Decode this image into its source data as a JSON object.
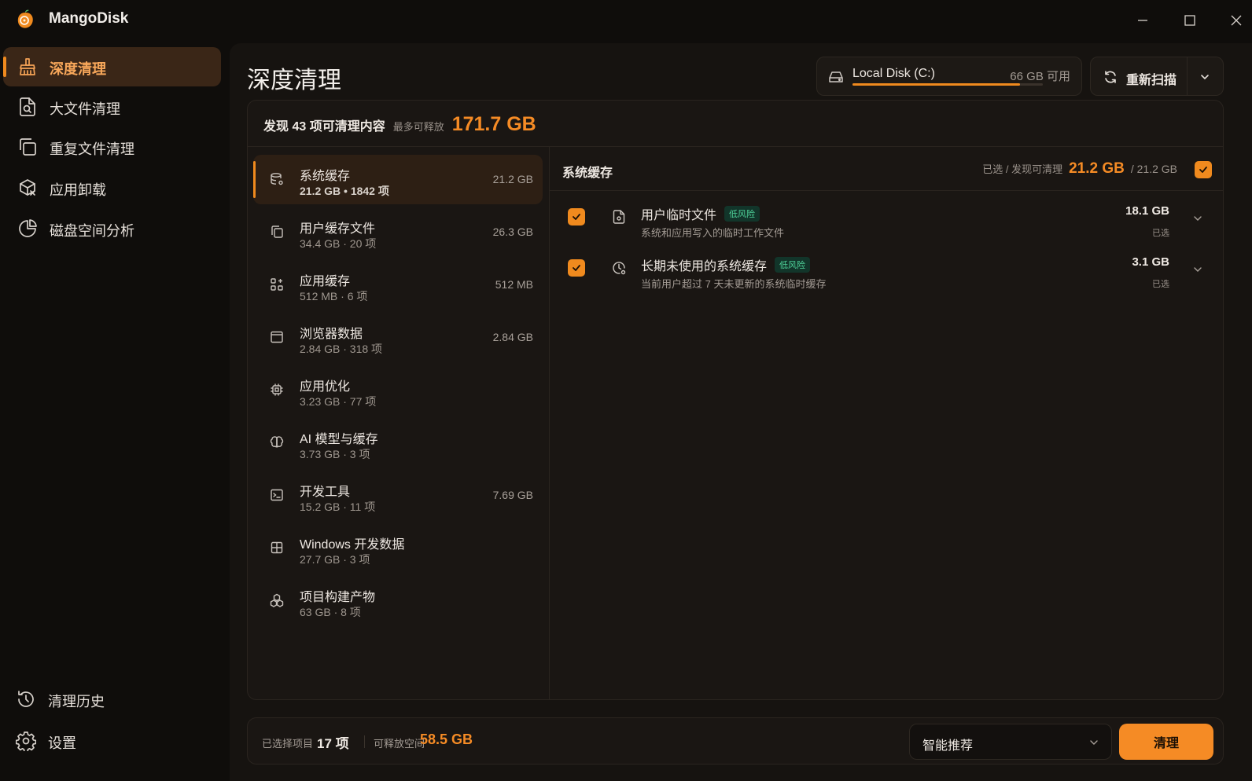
{
  "app": {
    "name": "MangoDisk"
  },
  "sidebar": {
    "items": [
      {
        "label": "深度清理",
        "icon": "broom-icon",
        "active": true
      },
      {
        "label": "大文件清理",
        "icon": "file-search-icon"
      },
      {
        "label": "重复文件清理",
        "icon": "copy-icon"
      },
      {
        "label": "应用卸载",
        "icon": "package-remove-icon"
      },
      {
        "label": "磁盘空间分析",
        "icon": "pie-chart-icon"
      }
    ],
    "bottom": [
      {
        "label": "清理历史",
        "icon": "history-icon"
      },
      {
        "label": "设置",
        "icon": "gear-icon"
      }
    ]
  },
  "header": {
    "title": "深度清理",
    "disk": {
      "name": "Local Disk (C:)",
      "free": "66 GB 可用",
      "used_fraction": 0.88
    },
    "rescan_label": "重新扫描"
  },
  "summary": {
    "text": "发现 43 项可清理内容",
    "sub": "最多可释放",
    "size": "171.7 GB"
  },
  "categories": [
    {
      "name": "系统缓存",
      "meta": "21.2 GB • 1842 项",
      "size": "21.2 GB",
      "icon": "database-gear-icon",
      "active": true
    },
    {
      "name": "用户缓存文件",
      "meta": "34.4 GB · 20 项",
      "size": "26.3 GB",
      "icon": "files-icon"
    },
    {
      "name": "应用缓存",
      "meta": "512 MB · 6 项",
      "size": "512 MB",
      "icon": "apps-icon"
    },
    {
      "name": "浏览器数据",
      "meta": "2.84 GB · 318 项",
      "size": "2.84 GB",
      "icon": "browser-icon"
    },
    {
      "name": "应用优化",
      "meta": "3.23 GB · 77 项",
      "size": "",
      "icon": "chip-icon"
    },
    {
      "name": "AI 模型与缓存",
      "meta": "3.73 GB · 3 项",
      "size": "",
      "icon": "brain-icon"
    },
    {
      "name": "开发工具",
      "meta": "15.2 GB · 11 项",
      "size": "7.69 GB",
      "icon": "terminal-icon"
    },
    {
      "name": "Windows 开发数据",
      "meta": "27.7 GB · 3 项",
      "size": "",
      "icon": "windows-icon"
    },
    {
      "name": "项目构建产物",
      "meta": "63 GB · 8 项",
      "size": "",
      "icon": "boxes-icon"
    }
  ],
  "detail": {
    "title": "系统缓存",
    "label": "已选 / 发现可清理",
    "selected": "21.2 GB",
    "total": "/ 21.2 GB",
    "entries": [
      {
        "name": "用户临时文件",
        "risk": "低风险",
        "desc": "系统和应用写入的临时工作文件",
        "size": "18.1 GB",
        "state": "已选",
        "icon": "file-gear-icon"
      },
      {
        "name": "长期未使用的系统缓存",
        "risk": "低风险",
        "desc": "当前用户超过 7 天未更新的系统临时缓存",
        "size": "3.1 GB",
        "state": "已选",
        "icon": "clock-gear-icon"
      }
    ]
  },
  "footer": {
    "selected_label": "已选择项目",
    "selected_count": "17 项",
    "free_label": "可释放空间",
    "free_size": "58.5 GB",
    "mode": "智能推荐",
    "clean_label": "清理"
  },
  "colors": {
    "accent": "#f58b25",
    "background": "#0f0d0b",
    "panel": "#161310"
  }
}
